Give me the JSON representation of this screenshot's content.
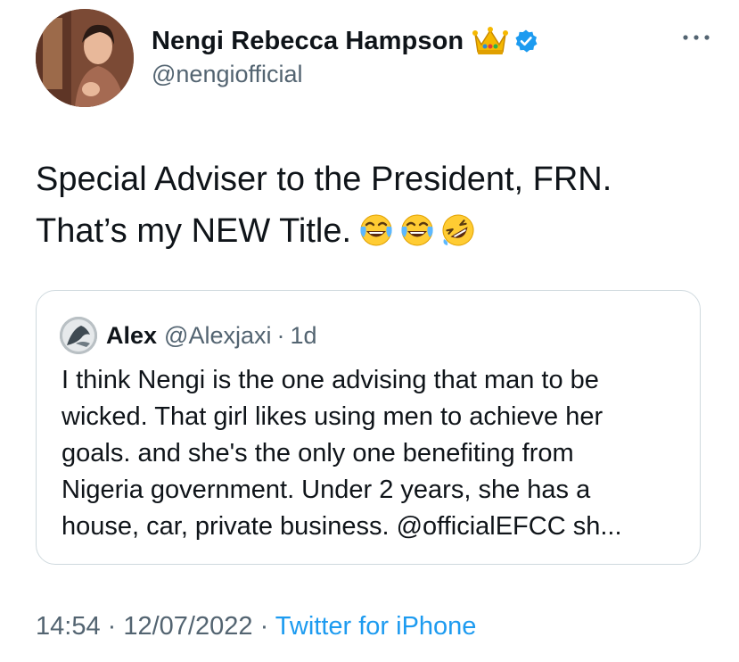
{
  "author": {
    "display_name": "Nengi Rebecca Hampson",
    "handle": "@nengiofficial",
    "badge_icon": "crown-icon",
    "verified_icon": "verified-badge-icon",
    "verified_color": "#1d9bf0"
  },
  "tweet": {
    "lines": [
      "Special Adviser to the President, FRN.",
      "That’s my NEW Title."
    ],
    "emojis": [
      "face-with-tears-of-joy-icon",
      "face-with-tears-of-joy-icon",
      "rolling-on-floor-laughing-icon"
    ]
  },
  "quote": {
    "name": "Alex",
    "handle": "@Alexjaxi",
    "separator": "·",
    "time": "1d",
    "lines": [
      "I think Nengi is the  one advising that man to be",
      "wicked. That girl likes using men to achieve her",
      "goals. and she's the only one benefiting from",
      "Nigeria government. Under 2 years, she has a",
      "house, car, private business. @officialEFCC sh..."
    ]
  },
  "meta": {
    "time": "14:54",
    "sep1": " · ",
    "date": "12/07/2022",
    "sep2": " · ",
    "source": "Twitter for iPhone"
  },
  "colors": {
    "text": "#0f1419",
    "secondary": "#536471",
    "accent": "#1d9bf0",
    "border": "#cfd9de"
  }
}
